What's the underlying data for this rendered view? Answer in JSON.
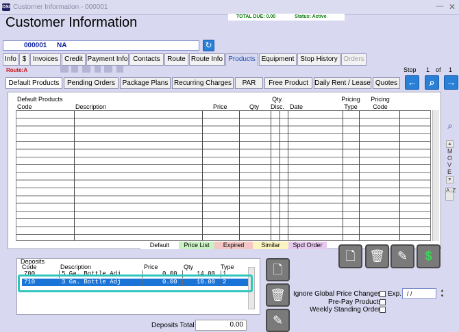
{
  "window": {
    "title": "Customer Information - 000001",
    "logo": "DSI",
    "minimize": "—",
    "close": "✕"
  },
  "summary": {
    "total_due_label": "TOTAL DUE:",
    "total_due": "0.00",
    "status_label": "Status:",
    "status": "Active"
  },
  "page_title": "Customer Information",
  "customer": {
    "id": "000001",
    "name": "NA"
  },
  "tabs": [
    {
      "label": "Info"
    },
    {
      "label": "$"
    },
    {
      "label": "Invoices"
    },
    {
      "label": "Credit"
    },
    {
      "label": "Payment Info"
    },
    {
      "label": "Contacts"
    },
    {
      "label": "Route"
    },
    {
      "label": "Route Info"
    },
    {
      "label": "Products"
    },
    {
      "label": "Equipment"
    },
    {
      "label": "Stop History"
    },
    {
      "label": "Orders"
    }
  ],
  "route_label": "Route:A",
  "stop": {
    "label": "Stop",
    "current": "1",
    "of": "of",
    "total": "1"
  },
  "subtabs": [
    {
      "label": "Default Products"
    },
    {
      "label": "Pending Orders"
    },
    {
      "label": "Package Plans"
    },
    {
      "label": "Recurring Charges"
    },
    {
      "label": "PAR"
    },
    {
      "label": "Free Product"
    },
    {
      "label": "Daily Rent / Lease"
    },
    {
      "label": "Quotes"
    }
  ],
  "products": {
    "section_label": "Default Products",
    "columns": {
      "code": "Code",
      "description": "Description",
      "price": "Price",
      "qty": "Qty",
      "qty_disc_1": "Qty.",
      "qty_disc_2": "Disc.",
      "date": "Date",
      "pricing_type_1": "Pricing",
      "pricing_type_2": "Type",
      "pricing_code_1": "Pricing",
      "pricing_code_2": "Code"
    }
  },
  "move_label": [
    "M",
    "O",
    "V",
    "E"
  ],
  "sort_label": "A↓Z",
  "legend": [
    {
      "label": "Default",
      "color": "#ffffff"
    },
    {
      "label": "Price List",
      "color": "#c9f2c3"
    },
    {
      "label": "Expired",
      "color": "#f4c6c6"
    },
    {
      "label": "Similar",
      "color": "#fbf4bf"
    },
    {
      "label": "Spcl Order",
      "color": "#e6c8ee"
    }
  ],
  "deposits": {
    "section_label": "Deposits",
    "columns": {
      "code": "Code",
      "description": "Description",
      "price": "Price",
      "qty": "Qty",
      "type": "Type"
    },
    "rows": [
      {
        "code": "700",
        "description": "5 Ga. Bottle Adj",
        "price": "0.00",
        "qty": "14.00",
        "type": "1"
      },
      {
        "code": "710",
        "description": "3 Ga. Bottle Adj",
        "price": "0.00",
        "qty": "10.00",
        "type": "2"
      }
    ],
    "total_label": "Deposits Total",
    "total": "0.00"
  },
  "options": {
    "ignore_global": "Ignore Global Price Changes.",
    "exp_label": "Exp.",
    "exp_value": "/ /",
    "prepay": "Pre-Pay Products",
    "weekly": "Weekly Standing Orders"
  },
  "icons": {
    "refresh": "refresh-icon",
    "nav_prev": "arrow-left-icon",
    "nav_search": "search-icon",
    "nav_next": "arrow-right-icon",
    "new": "new-document-icon",
    "delete": "trash-icon",
    "edit": "pencil-icon",
    "price": "dollar-icon"
  },
  "colors": {
    "accent": "#2a7fd6",
    "route": "#d01010",
    "active_tab_text": "#1a4fa8",
    "selected_row": "#1a74d8",
    "highlight": "#31c6bd"
  }
}
